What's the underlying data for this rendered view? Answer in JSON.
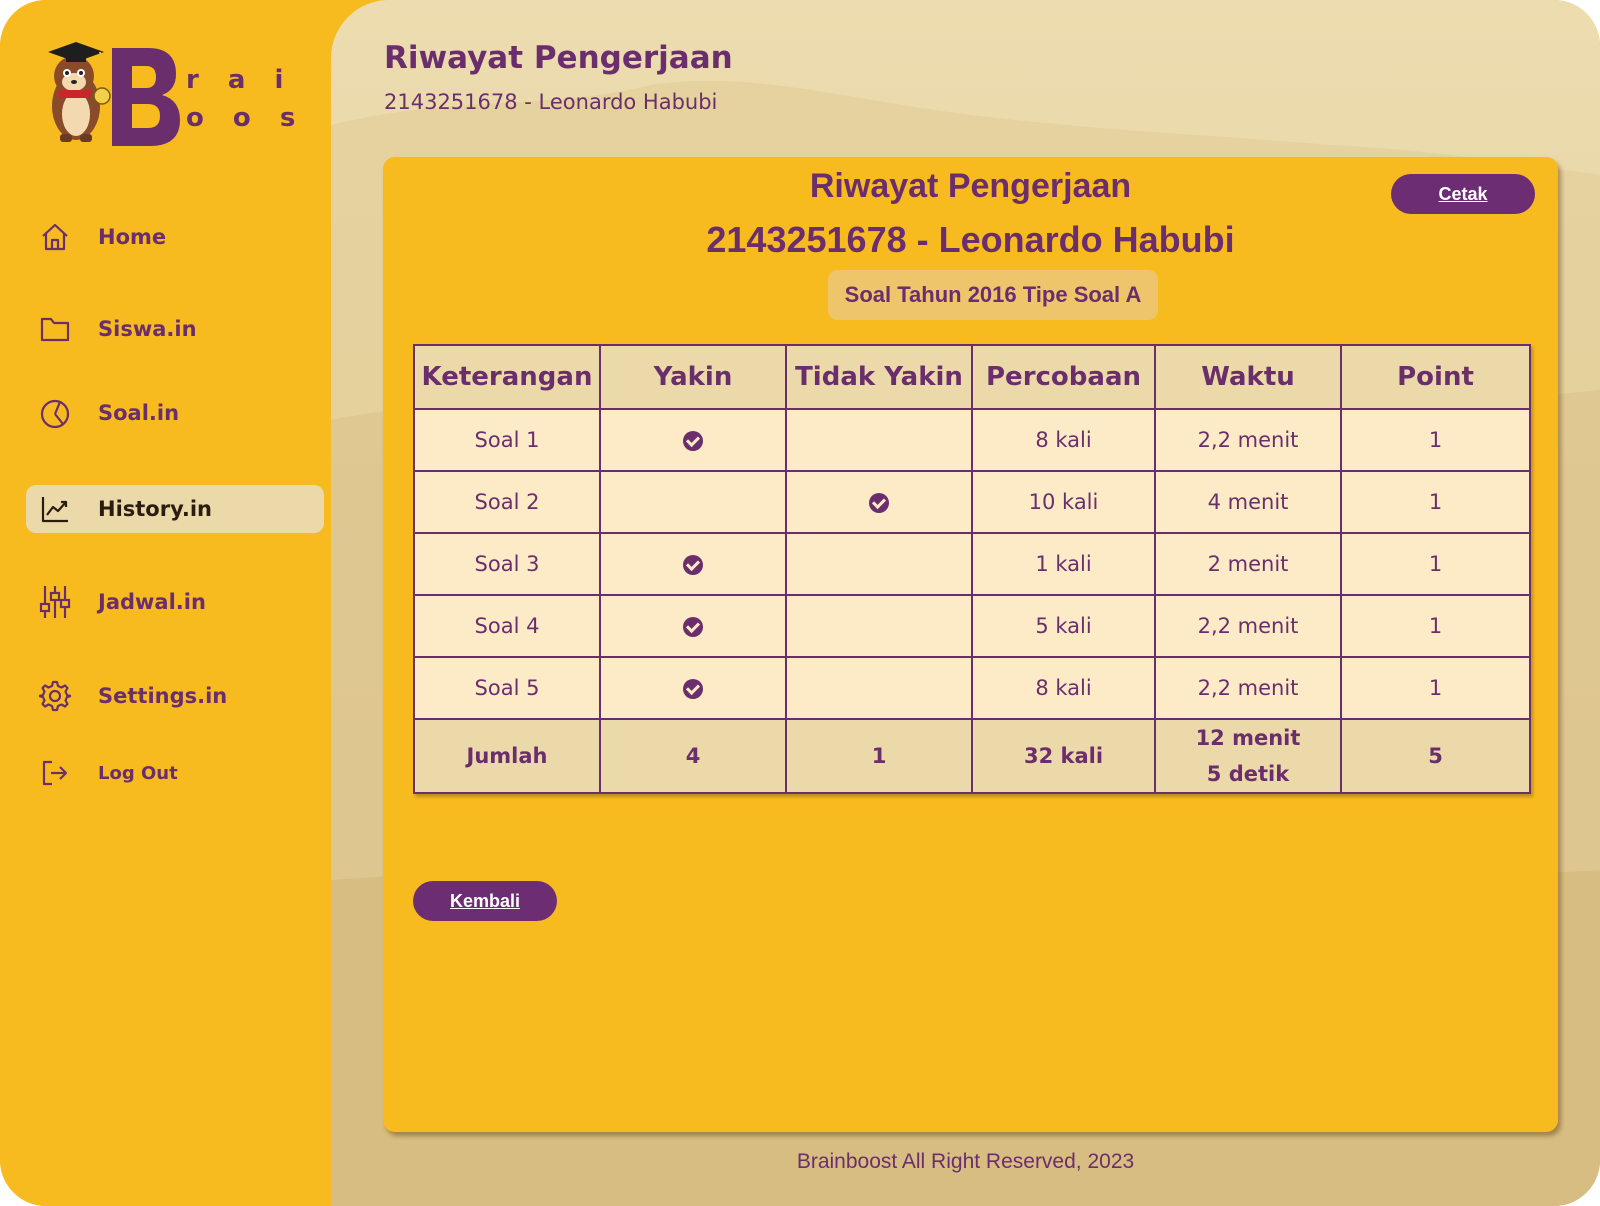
{
  "logo": {
    "letter": "B",
    "rain": "r a i n",
    "oost": "o o s t"
  },
  "sidebar": {
    "items": [
      {
        "label": "Home",
        "icon": "home-icon"
      },
      {
        "label": "Siswa.in",
        "icon": "folder-icon"
      },
      {
        "label": "Soal.in",
        "icon": "pie-chart-icon"
      },
      {
        "label": "History.in",
        "icon": "trending-up-icon",
        "active": true
      },
      {
        "label": "Jadwal.in",
        "icon": "sliders-icon"
      },
      {
        "label": "Settings.in",
        "icon": "gear-icon"
      },
      {
        "label": "Log Out",
        "icon": "logout-icon"
      }
    ]
  },
  "header": {
    "title": "Riwayat Pengerjaan",
    "subtitle": "2143251678 - Leonardo Habubi"
  },
  "card": {
    "title": "Riwayat Pengerjaan",
    "subtitle": "2143251678 - Leonardo Habubi",
    "badge": "Soal Tahun 2016 Tipe Soal A",
    "print_button": "Cetak",
    "back_button": "Kembali"
  },
  "table": {
    "headers": [
      "Keterangan",
      "Yakin",
      "Tidak Yakin",
      "Percobaan",
      "Waktu",
      "Point"
    ],
    "rows": [
      {
        "label": "Soal 1",
        "yakin": true,
        "tidak_yakin": false,
        "percobaan": "8 kali",
        "waktu": "2,2 menit",
        "point": "1"
      },
      {
        "label": "Soal 2",
        "yakin": false,
        "tidak_yakin": true,
        "percobaan": "10 kali",
        "waktu": "4 menit",
        "point": "1"
      },
      {
        "label": "Soal 3",
        "yakin": true,
        "tidak_yakin": false,
        "percobaan": "1 kali",
        "waktu": "2 menit",
        "point": "1"
      },
      {
        "label": "Soal 4",
        "yakin": true,
        "tidak_yakin": false,
        "percobaan": "5 kali",
        "waktu": "2,2 menit",
        "point": "1"
      },
      {
        "label": "Soal 5",
        "yakin": true,
        "tidak_yakin": false,
        "percobaan": "8 kali",
        "waktu": "2,2 menit",
        "point": "1"
      }
    ],
    "total": {
      "label": "Jumlah",
      "yakin": "4",
      "tidak_yakin": "1",
      "percobaan": "32 kali",
      "waktu_line1": "12 menit",
      "waktu_line2": "5 detik",
      "point": "5"
    }
  },
  "footer": {
    "text": "Brainboost All Right Reserved, 2023"
  },
  "colors": {
    "accent": "#6b2e6d",
    "background": "#f8bb1f",
    "cell": "#fdebc7",
    "header_cell": "#ecd9aa"
  }
}
